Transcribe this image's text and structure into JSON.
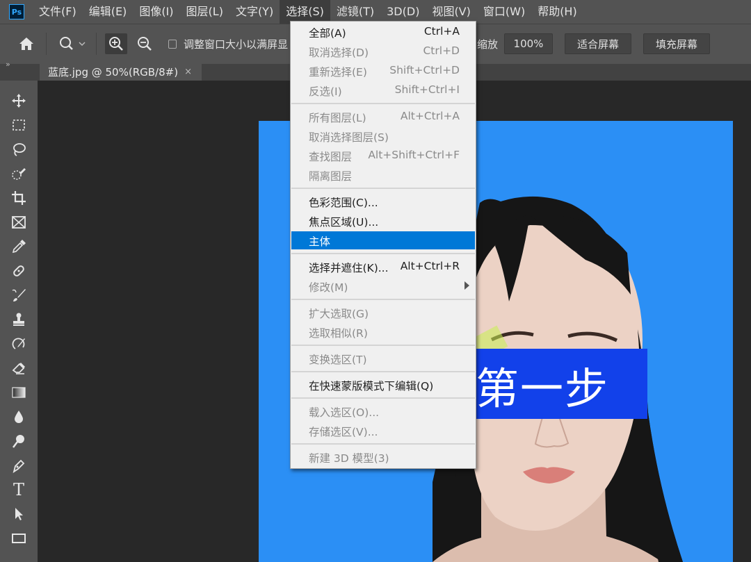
{
  "app": {
    "logo": "Ps"
  },
  "menubar": {
    "items": [
      "文件(F)",
      "编辑(E)",
      "图像(I)",
      "图层(L)",
      "文字(Y)",
      "选择(S)",
      "滤镜(T)",
      "3D(D)",
      "视图(V)",
      "窗口(W)",
      "帮助(H)"
    ],
    "active": "选择(S)"
  },
  "options": {
    "resize_label": "调整窗口大小以满屏显",
    "zoom_suffix": "缩放",
    "zoom_value": "100%",
    "fit_screen": "适合屏幕",
    "fill_screen": "填充屏幕"
  },
  "tab": {
    "title": "蓝底.jpg @ 50%(RGB/8#)",
    "close": "×",
    "collapse": "»"
  },
  "select_menu": {
    "items": [
      {
        "label": "全部(A)",
        "shortcut": "Ctrl+A",
        "enabled": true
      },
      {
        "label": "取消选择(D)",
        "shortcut": "Ctrl+D",
        "enabled": false
      },
      {
        "label": "重新选择(E)",
        "shortcut": "Shift+Ctrl+D",
        "enabled": false
      },
      {
        "label": "反选(I)",
        "shortcut": "Shift+Ctrl+I",
        "enabled": false
      },
      {
        "label": "所有图层(L)",
        "shortcut": "Alt+Ctrl+A",
        "enabled": false
      },
      {
        "label": "取消选择图层(S)",
        "shortcut": "",
        "enabled": false
      },
      {
        "label": "查找图层",
        "shortcut": "Alt+Shift+Ctrl+F",
        "enabled": false
      },
      {
        "label": "隔离图层",
        "shortcut": "",
        "enabled": false
      },
      {
        "label": "色彩范围(C)...",
        "shortcut": "",
        "enabled": true
      },
      {
        "label": "焦点区域(U)...",
        "shortcut": "",
        "enabled": true
      },
      {
        "label": "主体",
        "shortcut": "",
        "enabled": true,
        "highlighted": true
      },
      {
        "label": "选择并遮住(K)...",
        "shortcut": "Alt+Ctrl+R",
        "enabled": true
      },
      {
        "label": "修改(M)",
        "shortcut": "",
        "enabled": false,
        "submenu": true
      },
      {
        "label": "扩大选取(G)",
        "shortcut": "",
        "enabled": false
      },
      {
        "label": "选取相似(R)",
        "shortcut": "",
        "enabled": false
      },
      {
        "label": "变换选区(T)",
        "shortcut": "",
        "enabled": false
      },
      {
        "label": "在快速蒙版模式下编辑(Q)",
        "shortcut": "",
        "enabled": true
      },
      {
        "label": "载入选区(O)...",
        "shortcut": "",
        "enabled": false
      },
      {
        "label": "存储选区(V)...",
        "shortcut": "",
        "enabled": false
      },
      {
        "label": "新建 3D 模型(3)",
        "shortcut": "",
        "enabled": false
      }
    ]
  },
  "overlay": {
    "step_text": "第一步"
  },
  "colors": {
    "accent": "#0078d7",
    "photo_background": "#2b8ff5",
    "banner": "#1241ea"
  }
}
